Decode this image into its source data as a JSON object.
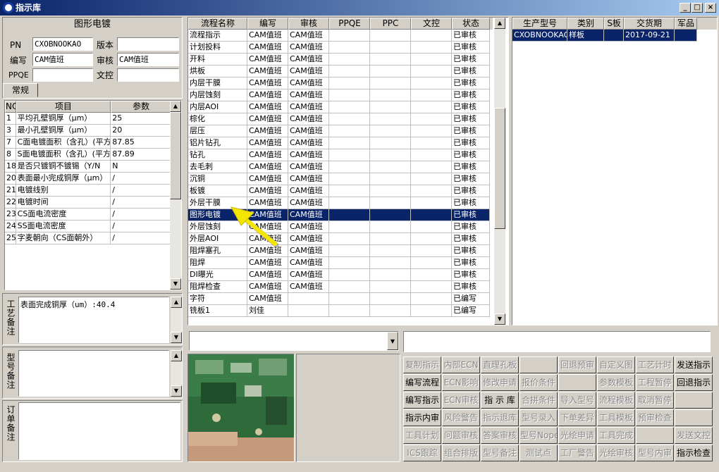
{
  "window": {
    "title": "指示库",
    "min": "_",
    "max": "□",
    "close": "×"
  },
  "left": {
    "header": "图形电镀",
    "fields": {
      "pn_label": "PN",
      "pn_value": "CXOBNOOKAO",
      "version_label": "版本",
      "version_value": "",
      "author_label": "编写",
      "author_value": "CAM值班",
      "review_label": "审核",
      "review_value": "CAM值班",
      "ppqe_label": "PPQE",
      "ppqe_value": "",
      "wenkong_label": "文控",
      "wenkong_value": ""
    },
    "tab": "常规",
    "param_grid": {
      "headers": [
        "NO",
        "项目",
        "参数"
      ],
      "rows": [
        [
          "1",
          "平均孔壁铜厚（μm）",
          "25"
        ],
        [
          "3",
          "最小孔壁铜厚（μm）",
          "20"
        ],
        [
          "7",
          "C面电镀面积（含孔）(平方",
          "87.85"
        ],
        [
          "8",
          "S面电镀面积（含孔）(平方",
          "87.89"
        ],
        [
          "18",
          "是否只镀铜不镀锡（Y/N",
          "N"
        ],
        [
          "20",
          "表面最小完成铜厚（μm）",
          "/"
        ],
        [
          "21",
          "电镀线别",
          "/"
        ],
        [
          "22",
          "电镀时间",
          "/"
        ],
        [
          "23",
          "CS面电流密度",
          "/"
        ],
        [
          "24",
          "SS面电流密度",
          "/"
        ],
        [
          "25",
          "字麦朝向（CS面朝外）",
          "/"
        ]
      ]
    },
    "memo1_label": "工艺备注",
    "memo1_text": "表面完成铜厚（um）:40.4",
    "memo2_label": "型号备注",
    "memo2_text": "",
    "memo3_label": "订单备注",
    "memo3_text": ""
  },
  "flow_grid": {
    "headers": [
      "流程名称",
      "编写",
      "审核",
      "PPQE",
      "PPC",
      "文控",
      "状态"
    ],
    "rows": [
      [
        "流程指示",
        "CAM值班",
        "CAM值班",
        "",
        "",
        "",
        "已审核"
      ],
      [
        "计划投料",
        "CAM值班",
        "CAM值班",
        "",
        "",
        "",
        "已审核"
      ],
      [
        "开料",
        "CAM值班",
        "CAM值班",
        "",
        "",
        "",
        "已审核"
      ],
      [
        "烘板",
        "CAM值班",
        "CAM值班",
        "",
        "",
        "",
        "已审核"
      ],
      [
        "内层干膜",
        "CAM值班",
        "CAM值班",
        "",
        "",
        "",
        "已审核"
      ],
      [
        "内层蚀刻",
        "CAM值班",
        "CAM值班",
        "",
        "",
        "",
        "已审核"
      ],
      [
        "内层AOI",
        "CAM值班",
        "CAM值班",
        "",
        "",
        "",
        "已审核"
      ],
      [
        "棕化",
        "CAM值班",
        "CAM值班",
        "",
        "",
        "",
        "已审核"
      ],
      [
        "层压",
        "CAM值班",
        "CAM值班",
        "",
        "",
        "",
        "已审核"
      ],
      [
        "铝片钻孔",
        "CAM值班",
        "CAM值班",
        "",
        "",
        "",
        "已审核"
      ],
      [
        "钻孔",
        "CAM值班",
        "CAM值班",
        "",
        "",
        "",
        "已审核"
      ],
      [
        "去毛刺",
        "CAM值班",
        "CAM值班",
        "",
        "",
        "",
        "已审核"
      ],
      [
        "沉铜",
        "CAM值班",
        "CAM值班",
        "",
        "",
        "",
        "已审核"
      ],
      [
        "板镀",
        "CAM值班",
        "CAM值班",
        "",
        "",
        "",
        "已审核"
      ],
      [
        "外层干膜",
        "CAM值班",
        "CAM值班",
        "",
        "",
        "",
        "已审核"
      ],
      [
        "图形电镀",
        "CAM值班",
        "CAM值班",
        "",
        "",
        "",
        "已审核"
      ],
      [
        "外层蚀刻",
        "CAM值班",
        "CAM值班",
        "",
        "",
        "",
        "已审核"
      ],
      [
        "外层AOI",
        "CAM值班",
        "CAM值班",
        "",
        "",
        "",
        "已审核"
      ],
      [
        "阻焊塞孔",
        "CAM值班",
        "CAM值班",
        "",
        "",
        "",
        "已审核"
      ],
      [
        "阻焊",
        "CAM值班",
        "CAM值班",
        "",
        "",
        "",
        "已审核"
      ],
      [
        "DI曝光",
        "CAM值班",
        "CAM值班",
        "",
        "",
        "",
        "已审核"
      ],
      [
        "阻焊检查",
        "CAM值班",
        "CAM值班",
        "",
        "",
        "",
        "已审核"
      ],
      [
        "字符",
        "CAM值班",
        "",
        "",
        "",
        "",
        "已编写"
      ],
      [
        "铣板1",
        "刘佳",
        "",
        "",
        "",
        "",
        "已编写"
      ]
    ],
    "selected_index": 15
  },
  "product_grid": {
    "headers": [
      "生产型号",
      "类别",
      "S板",
      "交货期",
      "军品"
    ],
    "rows": [
      [
        "CXOBNOOKAO",
        "样板",
        "",
        "2017-09-21",
        ""
      ]
    ]
  },
  "combo1_value": "",
  "text2_value": "",
  "buttons": [
    [
      {
        "label": "复制指示",
        "enabled": false
      },
      {
        "label": "内部ECN",
        "enabled": false
      },
      {
        "label": "直理孔板",
        "enabled": false
      },
      {
        "label": "",
        "enabled": false
      },
      {
        "label": "回退预审",
        "enabled": false
      },
      {
        "label": "自定义图",
        "enabled": false
      },
      {
        "label": "工艺计时",
        "enabled": false
      },
      {
        "label": "发送指示",
        "enabled": true
      }
    ],
    [
      {
        "label": "编写流程",
        "enabled": true
      },
      {
        "label": "ECN影响",
        "enabled": false
      },
      {
        "label": "修改申请",
        "enabled": false
      },
      {
        "label": "报价条件",
        "enabled": false
      },
      {
        "label": "",
        "enabled": false
      },
      {
        "label": "参数模板",
        "enabled": false
      },
      {
        "label": "工程暂停",
        "enabled": false
      },
      {
        "label": "回退指示",
        "enabled": true
      }
    ],
    [
      {
        "label": "编写指示",
        "enabled": true
      },
      {
        "label": "ECN审核",
        "enabled": false
      },
      {
        "label": "指 示 库",
        "enabled": true
      },
      {
        "label": "合拼条件",
        "enabled": false
      },
      {
        "label": "导入型号",
        "enabled": false
      },
      {
        "label": "流程模板",
        "enabled": false
      },
      {
        "label": "取消暂停",
        "enabled": false
      },
      {
        "label": "",
        "enabled": false
      }
    ],
    [
      {
        "label": "指示内审",
        "enabled": true
      },
      {
        "label": "风险警告",
        "enabled": false
      },
      {
        "label": "指示退库",
        "enabled": false
      },
      {
        "label": "型号录入",
        "enabled": false
      },
      {
        "label": "下单差异",
        "enabled": false
      },
      {
        "label": "工具模板",
        "enabled": false
      },
      {
        "label": "预审检查",
        "enabled": false
      },
      {
        "label": "",
        "enabled": false
      }
    ],
    [
      {
        "label": "工具计划",
        "enabled": false
      },
      {
        "label": "问题审核",
        "enabled": false
      },
      {
        "label": "答案审核",
        "enabled": false
      },
      {
        "label": "型号Nope",
        "enabled": false
      },
      {
        "label": "光绘申请",
        "enabled": false
      },
      {
        "label": "工具完成",
        "enabled": false
      },
      {
        "label": "",
        "enabled": false
      },
      {
        "label": "发送文控",
        "enabled": false
      }
    ],
    [
      {
        "label": "ICS跟踪",
        "enabled": false
      },
      {
        "label": "组合排版",
        "enabled": false
      },
      {
        "label": "型号备注",
        "enabled": false
      },
      {
        "label": "测试点",
        "enabled": false
      },
      {
        "label": "工厂警告",
        "enabled": false
      },
      {
        "label": "光绘审核",
        "enabled": false
      },
      {
        "label": "型号内审",
        "enabled": false
      },
      {
        "label": "指示检查",
        "enabled": true
      }
    ]
  ],
  "colors": {
    "selection": "#0a246a",
    "arrow": "#f5e600",
    "face": "#d4d0c8"
  }
}
